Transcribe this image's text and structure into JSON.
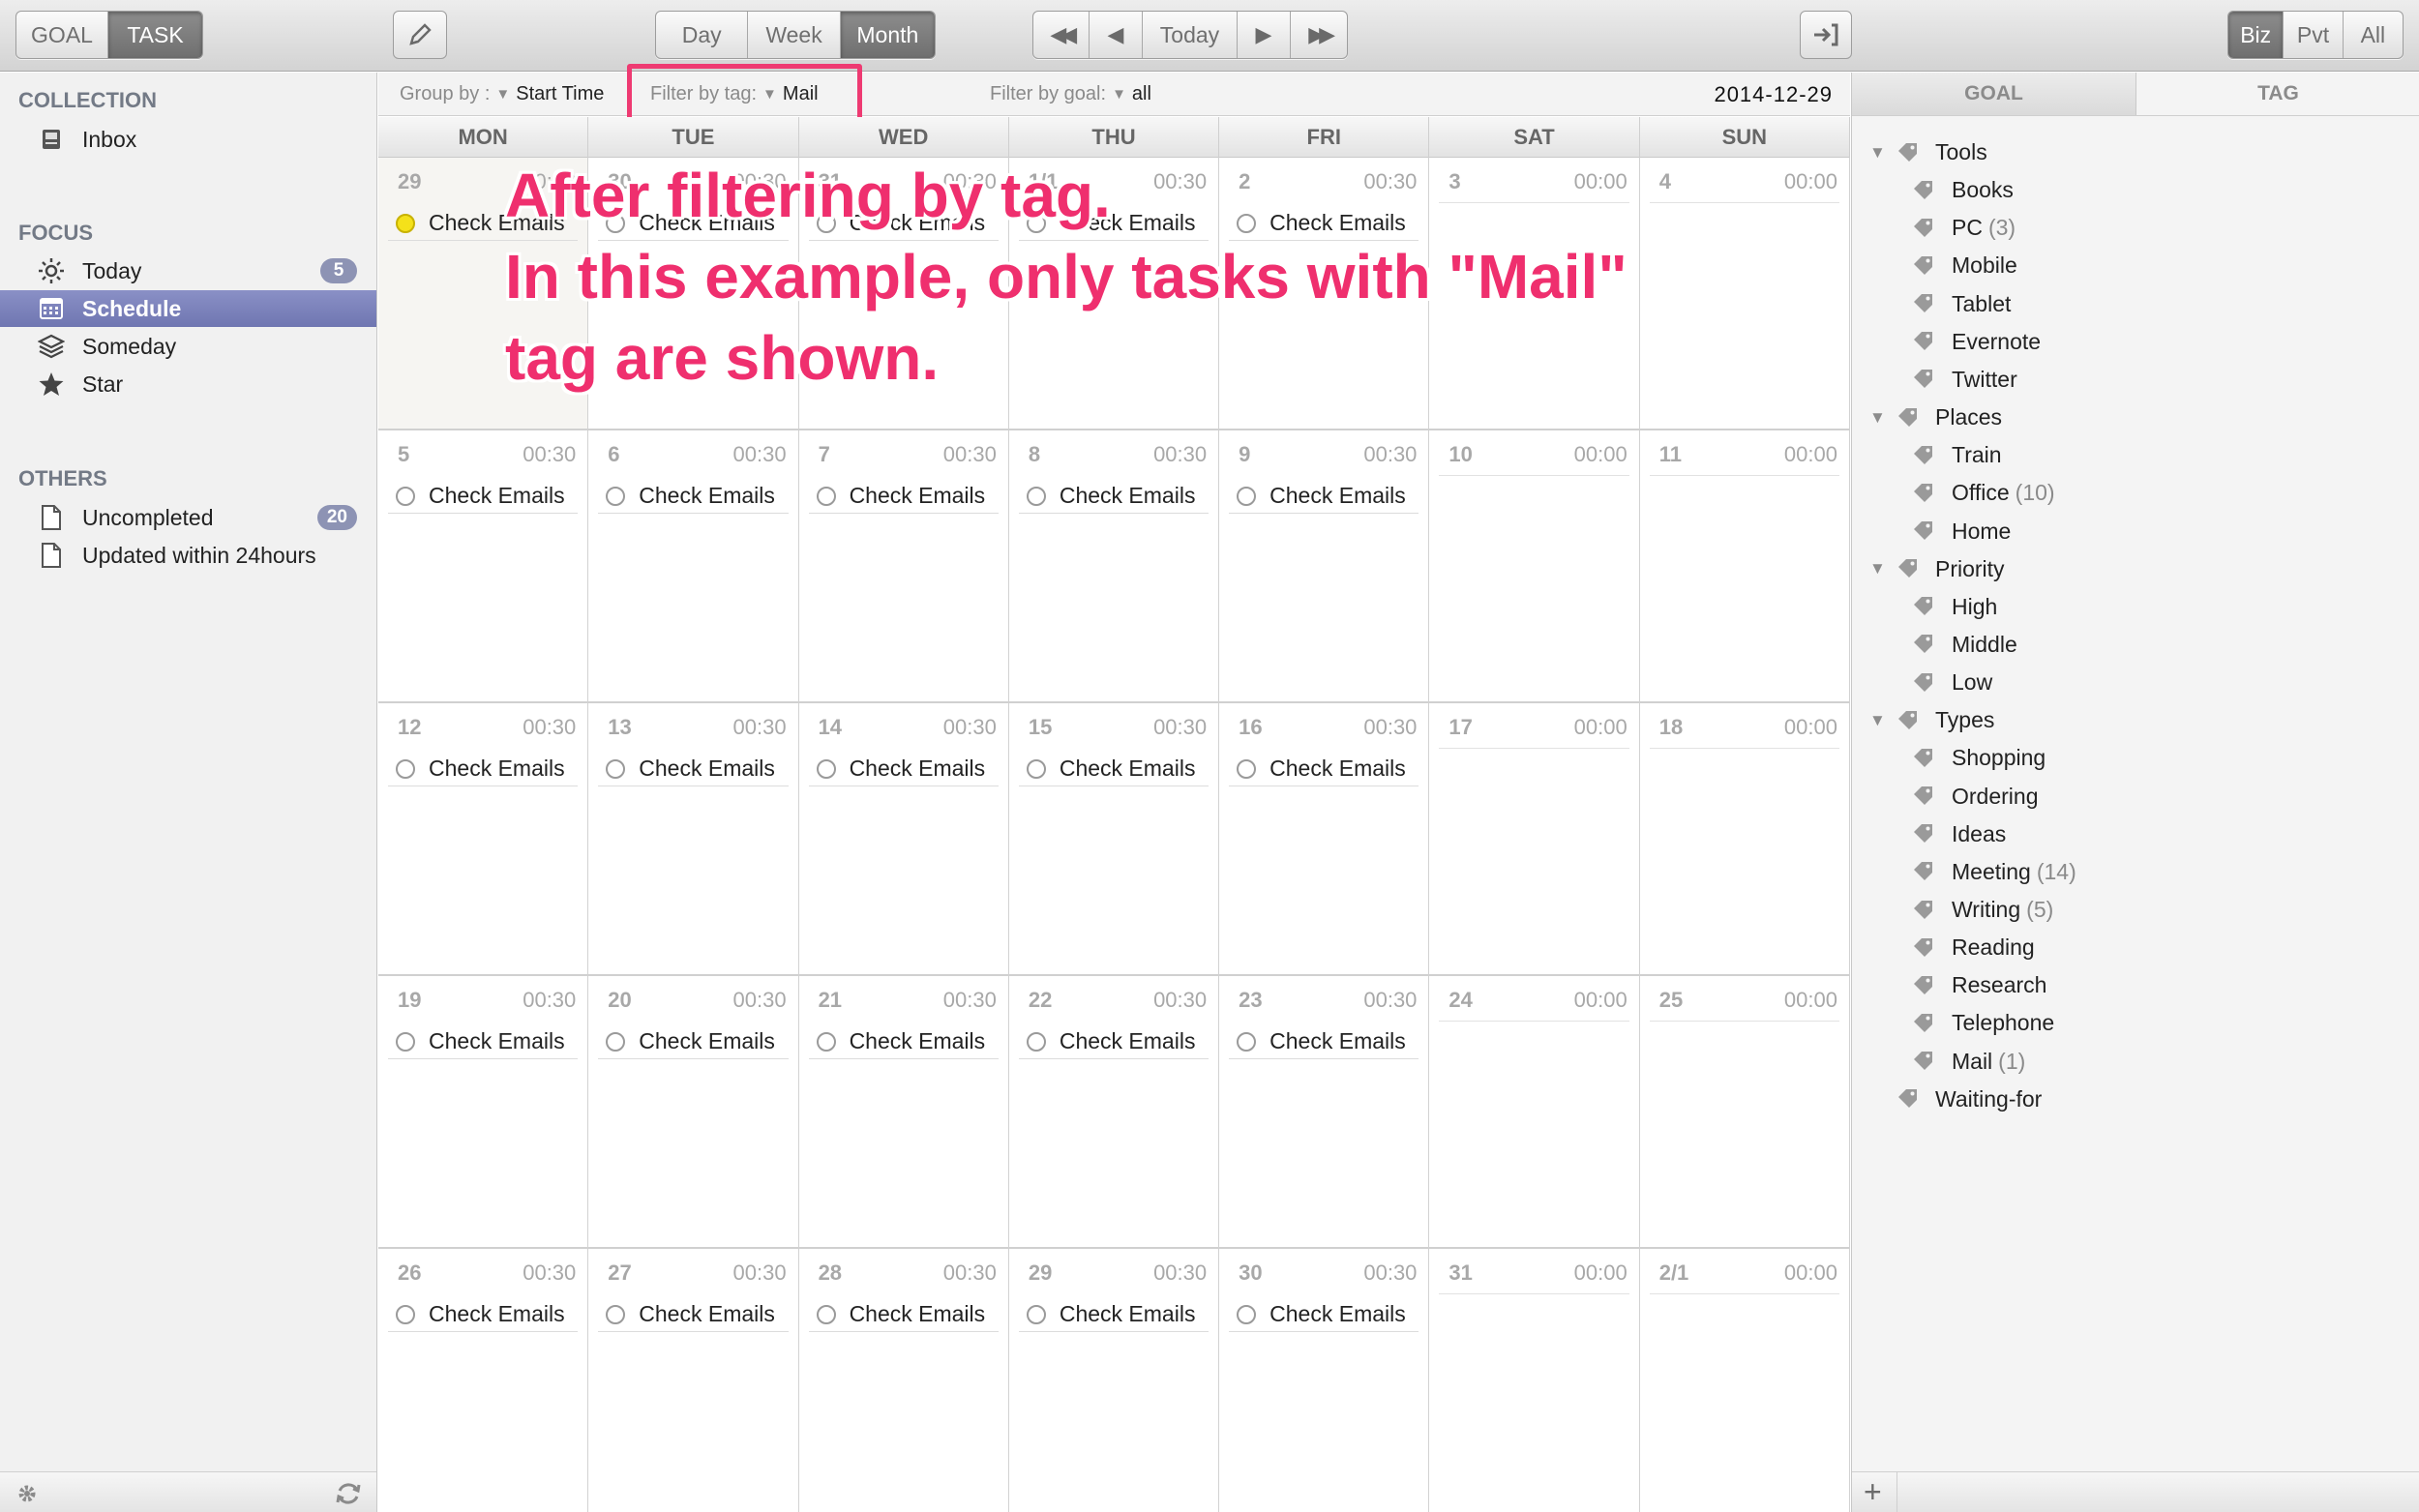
{
  "toolbar": {
    "mode_tabs": [
      {
        "label": "GOAL",
        "active": false
      },
      {
        "label": "TASK",
        "active": true
      }
    ],
    "view_tabs": [
      {
        "label": "Day",
        "active": false
      },
      {
        "label": "Week",
        "active": false
      },
      {
        "label": "Month",
        "active": true
      }
    ],
    "nav": {
      "prev_far": "◀◀",
      "prev": "◀",
      "today": "Today",
      "next": "▶",
      "next_far": "▶▶"
    },
    "scope_tabs": [
      {
        "label": "Biz",
        "active": true
      },
      {
        "label": "Pvt",
        "active": false
      },
      {
        "label": "All",
        "active": false
      }
    ]
  },
  "sidebar": {
    "collection": {
      "heading": "COLLECTION",
      "items": [
        {
          "label": "Inbox",
          "icon": "inbox-icon"
        }
      ]
    },
    "focus": {
      "heading": "FOCUS",
      "items": [
        {
          "label": "Today",
          "icon": "sun-icon",
          "badge": "5"
        },
        {
          "label": "Schedule",
          "icon": "calendar-icon",
          "selected": true
        },
        {
          "label": "Someday",
          "icon": "layers-icon"
        },
        {
          "label": "Star",
          "icon": "star-icon"
        }
      ]
    },
    "others": {
      "heading": "OTHERS",
      "items": [
        {
          "label": "Uncompleted",
          "icon": "document-icon",
          "badge": "20"
        },
        {
          "label": "Updated within 24hours",
          "icon": "document-icon"
        }
      ]
    }
  },
  "filterbar": {
    "group_by_label": "Group by :",
    "group_by_value": "Start Time",
    "tag_label": "Filter by tag:",
    "tag_value": "Mail",
    "goal_label": "Filter by goal:",
    "goal_value": "all",
    "date": "2014-12-29"
  },
  "calendar": {
    "days": [
      "MON",
      "TUE",
      "WED",
      "THU",
      "FRI",
      "SAT",
      "SUN"
    ],
    "weeks": [
      [
        {
          "day": "29",
          "time": "00:30",
          "task": "Check Emails",
          "today": true,
          "status": "yellow"
        },
        {
          "day": "30",
          "time": "00:30",
          "task": "Check Emails"
        },
        {
          "day": "31",
          "time": "00:30",
          "task": "Check Emails"
        },
        {
          "day": "1/1",
          "time": "00:30",
          "task": "Check Emails"
        },
        {
          "day": "2",
          "time": "00:30",
          "task": "Check Emails"
        },
        {
          "day": "3",
          "time": "00:00",
          "task": ""
        },
        {
          "day": "4",
          "time": "00:00",
          "task": ""
        }
      ],
      [
        {
          "day": "5",
          "time": "00:30",
          "task": "Check Emails"
        },
        {
          "day": "6",
          "time": "00:30",
          "task": "Check Emails"
        },
        {
          "day": "7",
          "time": "00:30",
          "task": "Check Emails"
        },
        {
          "day": "8",
          "time": "00:30",
          "task": "Check Emails"
        },
        {
          "day": "9",
          "time": "00:30",
          "task": "Check Emails"
        },
        {
          "day": "10",
          "time": "00:00",
          "task": ""
        },
        {
          "day": "11",
          "time": "00:00",
          "task": ""
        }
      ],
      [
        {
          "day": "12",
          "time": "00:30",
          "task": "Check Emails"
        },
        {
          "day": "13",
          "time": "00:30",
          "task": "Check Emails"
        },
        {
          "day": "14",
          "time": "00:30",
          "task": "Check Emails"
        },
        {
          "day": "15",
          "time": "00:30",
          "task": "Check Emails"
        },
        {
          "day": "16",
          "time": "00:30",
          "task": "Check Emails"
        },
        {
          "day": "17",
          "time": "00:00",
          "task": ""
        },
        {
          "day": "18",
          "time": "00:00",
          "task": ""
        }
      ],
      [
        {
          "day": "19",
          "time": "00:30",
          "task": "Check Emails"
        },
        {
          "day": "20",
          "time": "00:30",
          "task": "Check Emails"
        },
        {
          "day": "21",
          "time": "00:30",
          "task": "Check Emails"
        },
        {
          "day": "22",
          "time": "00:30",
          "task": "Check Emails"
        },
        {
          "day": "23",
          "time": "00:30",
          "task": "Check Emails"
        },
        {
          "day": "24",
          "time": "00:00",
          "task": ""
        },
        {
          "day": "25",
          "time": "00:00",
          "task": ""
        }
      ],
      [
        {
          "day": "26",
          "time": "00:30",
          "task": "Check Emails"
        },
        {
          "day": "27",
          "time": "00:30",
          "task": "Check Emails"
        },
        {
          "day": "28",
          "time": "00:30",
          "task": "Check Emails"
        },
        {
          "day": "29",
          "time": "00:30",
          "task": "Check Emails"
        },
        {
          "day": "30",
          "time": "00:30",
          "task": "Check Emails"
        },
        {
          "day": "31",
          "time": "00:00",
          "task": ""
        },
        {
          "day": "2/1",
          "time": "00:00",
          "task": ""
        }
      ]
    ]
  },
  "annotation": {
    "lines": [
      "After filtering by tag.",
      "In this example, only tasks with \"Mail\"",
      "tag are shown."
    ],
    "color": "#ef2f6e"
  },
  "right_panel": {
    "tabs": [
      {
        "label": "GOAL"
      },
      {
        "label": "TAG",
        "active": true
      }
    ],
    "tags": [
      {
        "label": "Tools",
        "level": 0,
        "expanded": true
      },
      {
        "label": "Books",
        "level": 1
      },
      {
        "label": "PC",
        "level": 1,
        "count": "(3)"
      },
      {
        "label": "Mobile",
        "level": 1
      },
      {
        "label": "Tablet",
        "level": 1
      },
      {
        "label": "Evernote",
        "level": 1
      },
      {
        "label": "Twitter",
        "level": 1
      },
      {
        "label": "Places",
        "level": 0,
        "expanded": true
      },
      {
        "label": "Train",
        "level": 1
      },
      {
        "label": "Office",
        "level": 1,
        "count": "(10)"
      },
      {
        "label": "Home",
        "level": 1
      },
      {
        "label": "Priority",
        "level": 0,
        "expanded": true
      },
      {
        "label": "High",
        "level": 1
      },
      {
        "label": "Middle",
        "level": 1
      },
      {
        "label": "Low",
        "level": 1
      },
      {
        "label": "Types",
        "level": 0,
        "expanded": true
      },
      {
        "label": "Shopping",
        "level": 1
      },
      {
        "label": "Ordering",
        "level": 1
      },
      {
        "label": "Ideas",
        "level": 1
      },
      {
        "label": "Meeting",
        "level": 1,
        "count": "(14)"
      },
      {
        "label": "Writing",
        "level": 1,
        "count": "(5)"
      },
      {
        "label": "Reading",
        "level": 1
      },
      {
        "label": "Research",
        "level": 1
      },
      {
        "label": "Telephone",
        "level": 1
      },
      {
        "label": "Mail",
        "level": 1,
        "count": "(1)"
      },
      {
        "label": "Waiting-for",
        "level": 0,
        "noarrow": true
      }
    ],
    "add_label": "+"
  },
  "colors": {
    "accent_selection": "#747bb5",
    "highlight": "#ee3a72",
    "today_dot": "#f4e11a"
  }
}
